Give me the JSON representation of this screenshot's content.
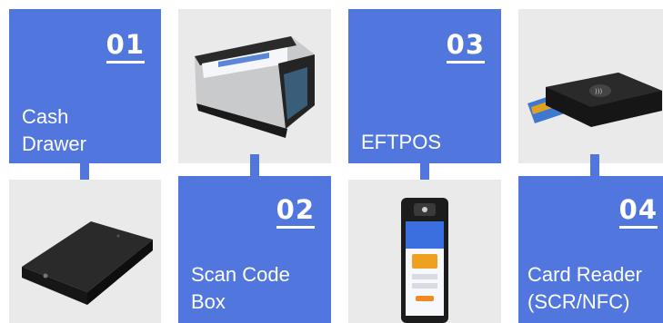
{
  "items": [
    {
      "number": "01",
      "title": "Cash\nDrawer",
      "device": "cash-drawer"
    },
    {
      "number": "02",
      "title": "Scan Code\nBox",
      "device": "scan-code-box"
    },
    {
      "number": "03",
      "title": "EFTPOS",
      "device": "eftpos-terminal"
    },
    {
      "number": "04",
      "title": "Card Reader\n(SCR/NFC)",
      "device": "card-reader"
    }
  ],
  "colors": {
    "accent": "#5176de",
    "tile_bg": "#eaeaea"
  }
}
